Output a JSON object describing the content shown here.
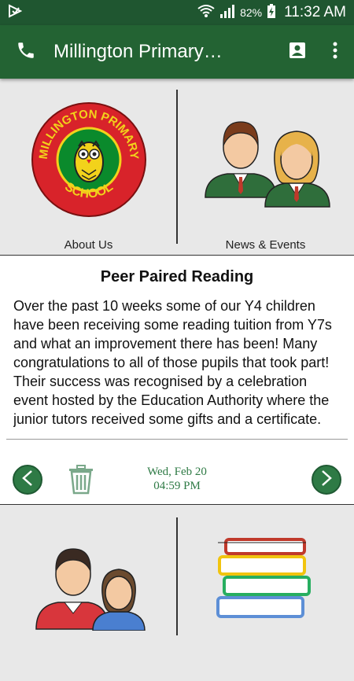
{
  "status": {
    "battery": "82%",
    "time": "11:32 AM"
  },
  "appbar": {
    "title": "Millington Primary…"
  },
  "tiles": [
    {
      "label": "About Us",
      "logo_top": "MILLINGTON PRIMARY",
      "logo_bottom": "SCHOOL"
    },
    {
      "label": "News & Events"
    }
  ],
  "card": {
    "title": "Peer Paired Reading",
    "body": "Over the past 10 weeks some of our Y4 children have been receiving some reading tuition from Y7s and what an improvement there has been! Many congratulations to all of those pupils that took part! Their success was recognised by a celebration event hosted by the Education Authority where the junior tutors received some gifts and a certificate.",
    "date": "Wed, Feb 20",
    "time": "04:59 PM"
  },
  "colors": {
    "primary": "#236333",
    "statusbar": "#1f5630",
    "accent": "#2e7a45"
  }
}
